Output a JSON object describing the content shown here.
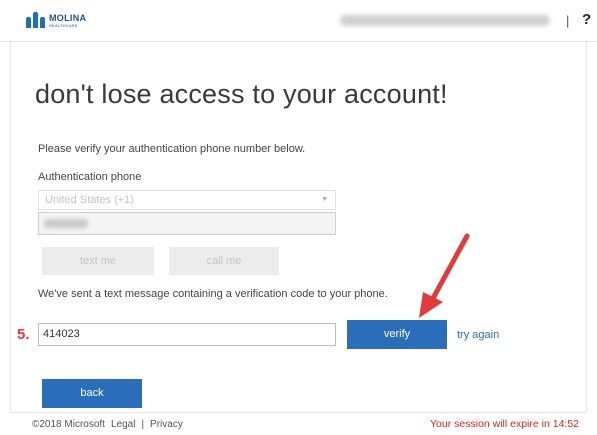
{
  "header": {
    "logo_name": "MOLINA",
    "logo_sub": "HEALTHCARE",
    "separator": "|",
    "help_label": "?"
  },
  "main": {
    "title": "don't lose access to your account!",
    "instruction": "Please verify your authentication phone number below.",
    "phone_label": "Authentication phone",
    "country_value": "United States (+1)",
    "text_me_label": "text me",
    "call_me_label": "call me",
    "sent_message": "We've sent a text message containing a verification code to your phone.",
    "step_number": "5.",
    "code_value": "414023",
    "verify_label": "verify",
    "try_again_label": "try again",
    "back_label": "back"
  },
  "footer": {
    "copyright": "©2018 Microsoft",
    "legal": "Legal",
    "divider": "|",
    "privacy": "Privacy",
    "session": "Your session will expire in 14:52"
  },
  "colors": {
    "accent": "#2a6ebb",
    "annotation_red": "#e23b3b",
    "session_red": "#d42626"
  }
}
